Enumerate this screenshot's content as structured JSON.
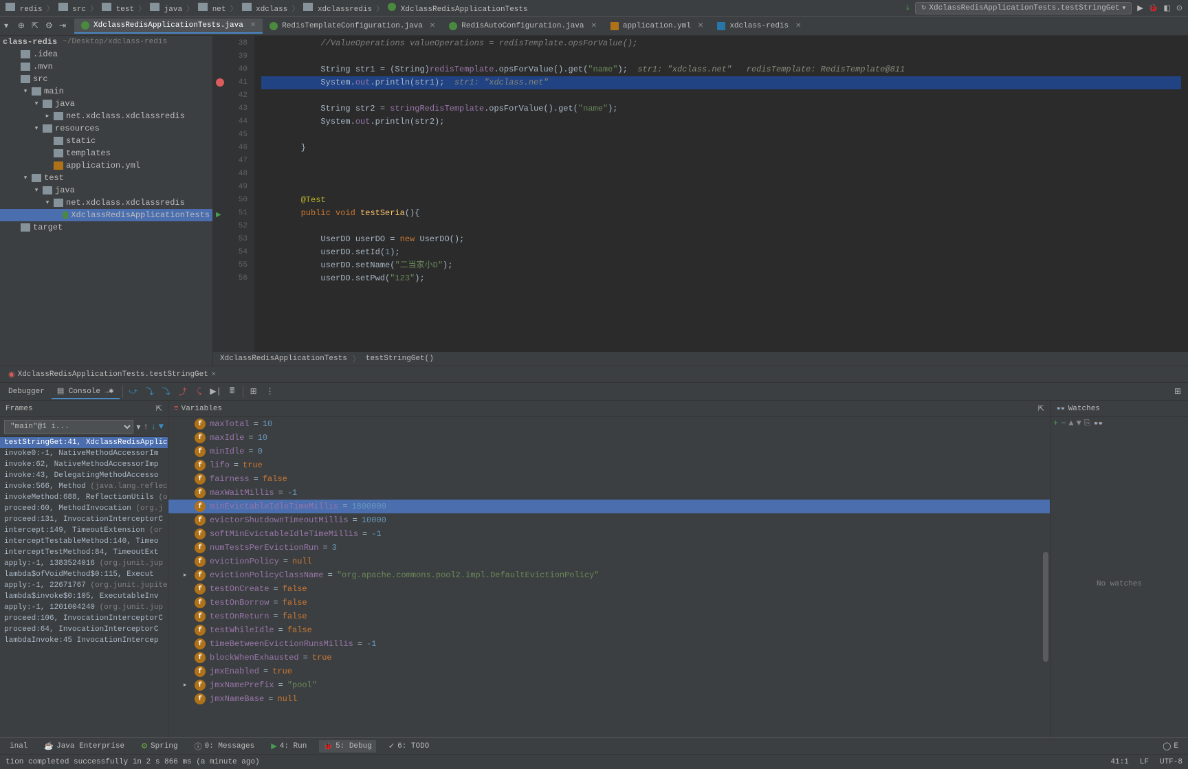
{
  "nav": {
    "crumbs": [
      "redis",
      "src",
      "test",
      "java",
      "net",
      "xdclass",
      "xdclassredis",
      "XdclassRedisApplicationTests"
    ],
    "runConfig": "XdclassRedisApplicationTests.testStringGet"
  },
  "tabs": [
    {
      "label": "XdclassRedisApplicationTests.java",
      "type": "class",
      "active": true
    },
    {
      "label": "RedisTemplateConfiguration.java",
      "type": "class",
      "active": false
    },
    {
      "label": "RedisAutoConfiguration.java",
      "type": "class",
      "active": false
    },
    {
      "label": "application.yml",
      "type": "yml",
      "active": false
    },
    {
      "label": "xdclass-redis",
      "type": "md",
      "active": false
    }
  ],
  "tree": {
    "root": "class-redis",
    "rootPath": "~/Desktop/xdclass-redis",
    "items": [
      {
        "depth": 1,
        "label": ".idea",
        "icon": "folder",
        "arrow": ""
      },
      {
        "depth": 1,
        "label": ".mvn",
        "icon": "folder",
        "arrow": ""
      },
      {
        "depth": 1,
        "label": "src",
        "icon": "folder",
        "arrow": ""
      },
      {
        "depth": 2,
        "label": "main",
        "icon": "folder",
        "arrow": "▾"
      },
      {
        "depth": 3,
        "label": "java",
        "icon": "folder",
        "arrow": "▾"
      },
      {
        "depth": 4,
        "label": "net.xdclass.xdclassredis",
        "icon": "folder",
        "arrow": "▸"
      },
      {
        "depth": 3,
        "label": "resources",
        "icon": "folder",
        "arrow": "▾"
      },
      {
        "depth": 4,
        "label": "static",
        "icon": "folder",
        "arrow": ""
      },
      {
        "depth": 4,
        "label": "templates",
        "icon": "folder",
        "arrow": ""
      },
      {
        "depth": 4,
        "label": "application.yml",
        "icon": "yml",
        "arrow": ""
      },
      {
        "depth": 2,
        "label": "test",
        "icon": "folder",
        "arrow": "▾"
      },
      {
        "depth": 3,
        "label": "java",
        "icon": "folder",
        "arrow": "▾"
      },
      {
        "depth": 4,
        "label": "net.xdclass.xdclassredis",
        "icon": "folder",
        "arrow": "▾"
      },
      {
        "depth": 5,
        "label": "XdclassRedisApplicationTests",
        "icon": "class",
        "arrow": "",
        "selected": true
      },
      {
        "depth": 1,
        "label": "target",
        "icon": "folder",
        "arrow": ""
      }
    ]
  },
  "editor": {
    "startLine": 38,
    "highlightedLine": 41,
    "lines": [
      {
        "n": 38,
        "html": "            <span class='comment'>//ValueOperations valueOperations = redisTemplate.opsForValue();</span>"
      },
      {
        "n": 39,
        "html": ""
      },
      {
        "n": 40,
        "html": "            String str1 = (String)<span class='field'>redisTemplate</span>.opsForValue().get(<span class='str'>\"name\"</span>);  <span class='inline-hint'>str1: \"xdclass.net\"   redisTemplate: RedisTemplate@811</span>"
      },
      {
        "n": 41,
        "html": "            System.<span class='field'>out</span>.println(str1);  <span class='inline-hint'>str1: \"xdclass.net\"</span>",
        "bp": true,
        "hl": true
      },
      {
        "n": 42,
        "html": ""
      },
      {
        "n": 43,
        "html": "            String str2 = <span class='field'>stringRedisTemplate</span>.opsForValue().get(<span class='str'>\"name\"</span>);"
      },
      {
        "n": 44,
        "html": "            System.<span class='field'>out</span>.println(str2);"
      },
      {
        "n": 45,
        "html": ""
      },
      {
        "n": 46,
        "html": "        }"
      },
      {
        "n": 47,
        "html": ""
      },
      {
        "n": 48,
        "html": ""
      },
      {
        "n": 49,
        "html": ""
      },
      {
        "n": 50,
        "html": "        <span class='anno'>@Test</span>"
      },
      {
        "n": 51,
        "html": "        <span class='kw'>public</span> <span class='kw'>void</span> <span class='method'>testSeria</span>(){",
        "run": true
      },
      {
        "n": 52,
        "html": ""
      },
      {
        "n": 53,
        "html": "            UserDO userDO = <span class='kw'>new</span> UserDO();"
      },
      {
        "n": 54,
        "html": "            userDO.setId(<span class='num'>1</span>);"
      },
      {
        "n": 55,
        "html": "            userDO.setName(<span class='str'>\"二当家小D\"</span>);"
      },
      {
        "n": 56,
        "html": "            userDO.setPwd(<span class='str'>\"123\"</span>);"
      }
    ],
    "breadcrumb": [
      "XdclassRedisApplicationTests",
      "testStringGet()"
    ]
  },
  "debugTabs": {
    "runTab": "XdclassRedisApplicationTests.testStringGet",
    "debugger": "Debugger",
    "console": "Console"
  },
  "frames": {
    "title": "Frames",
    "thread": "\"main\"@1 i...",
    "list": [
      {
        "text": "testStringGet:41, XdclassRedisApplic",
        "selected": true
      },
      {
        "text": "invoke0:-1, NativeMethodAccessorIm",
        "dim": false
      },
      {
        "text": "invoke:62, NativeMethodAccessorImp",
        "dim": false
      },
      {
        "text": "invoke:43, DelegatingMethodAccesso",
        "dim": false
      },
      {
        "text": "invoke:566, Method ",
        "suffix": "(java.lang.reflect"
      },
      {
        "text": "invokeMethod:688, ReflectionUtils ",
        "suffix": "(o"
      },
      {
        "text": "proceed:60, MethodInvocation ",
        "suffix": "(org.j"
      },
      {
        "text": "proceed:131, InvocationInterceptorC",
        "dim": false
      },
      {
        "text": "intercept:149, TimeoutExtension ",
        "suffix": "(or"
      },
      {
        "text": "interceptTestableMethod:140, Timeo",
        "dim": false
      },
      {
        "text": "interceptTestMethod:84, TimeoutExt",
        "dim": false
      },
      {
        "text": "apply:-1, 1383524016 ",
        "suffix": "(org.junit.jup"
      },
      {
        "text": "lambda$ofVoidMethod$0:115, Execut",
        "dim": false
      },
      {
        "text": "apply:-1, 22671767 ",
        "suffix": "(org.junit.jupite"
      },
      {
        "text": "lambda$invoke$0:105, ExecutableInv",
        "dim": false
      },
      {
        "text": "apply:-1, 1201004240 ",
        "suffix": "(org.junit.jup"
      },
      {
        "text": "proceed:106, InvocationInterceptorC",
        "dim": false
      },
      {
        "text": "proceed:64, InvocationInterceptorC",
        "dim": false
      },
      {
        "text": "lambdaInvoke:45 InvocationIntercep",
        "dim": false
      }
    ]
  },
  "variables": {
    "title": "Variables",
    "list": [
      {
        "name": "maxTotal",
        "val": "10",
        "type": "num"
      },
      {
        "name": "maxIdle",
        "val": "10",
        "type": "num"
      },
      {
        "name": "minIdle",
        "val": "0",
        "type": "num"
      },
      {
        "name": "lifo",
        "val": "true",
        "type": "bool"
      },
      {
        "name": "fairness",
        "val": "false",
        "type": "bool"
      },
      {
        "name": "maxWaitMillis",
        "val": "-1",
        "type": "num"
      },
      {
        "name": "minEvictableIdleTimeMillis",
        "val": "1800000",
        "type": "num",
        "selected": true
      },
      {
        "name": "evictorShutdownTimeoutMillis",
        "val": "10000",
        "type": "num"
      },
      {
        "name": "softMinEvictableIdleTimeMillis",
        "val": "-1",
        "type": "num"
      },
      {
        "name": "numTestsPerEvictionRun",
        "val": "3",
        "type": "num"
      },
      {
        "name": "evictionPolicy",
        "val": "null",
        "type": "null"
      },
      {
        "name": "evictionPolicyClassName",
        "val": "\"org.apache.commons.pool2.impl.DefaultEvictionPolicy\"",
        "type": "str",
        "expand": true
      },
      {
        "name": "testOnCreate",
        "val": "false",
        "type": "bool"
      },
      {
        "name": "testOnBorrow",
        "val": "false",
        "type": "bool"
      },
      {
        "name": "testOnReturn",
        "val": "false",
        "type": "bool"
      },
      {
        "name": "testWhileIdle",
        "val": "false",
        "type": "bool"
      },
      {
        "name": "timeBetweenEvictionRunsMillis",
        "val": "-1",
        "type": "num"
      },
      {
        "name": "blockWhenExhausted",
        "val": "true",
        "type": "bool"
      },
      {
        "name": "jmxEnabled",
        "val": "true",
        "type": "bool"
      },
      {
        "name": "jmxNamePrefix",
        "val": "\"pool\"",
        "type": "str",
        "expand": true
      },
      {
        "name": "jmxNameBase",
        "val": "null",
        "type": "null"
      }
    ]
  },
  "watches": {
    "title": "Watches",
    "empty": "No watches"
  },
  "bottomTabs": {
    "terminal": "inal",
    "javaEE": "Java Enterprise",
    "spring": "Spring",
    "messages": "0: Messages",
    "run": "4: Run",
    "debug": "5: Debug",
    "todo": "6: TODO"
  },
  "status": {
    "message": "tion completed successfully in 2 s 866 ms (a minute ago)",
    "position": "41:1",
    "lineEnding": "LF",
    "encoding": "UTF-8"
  }
}
